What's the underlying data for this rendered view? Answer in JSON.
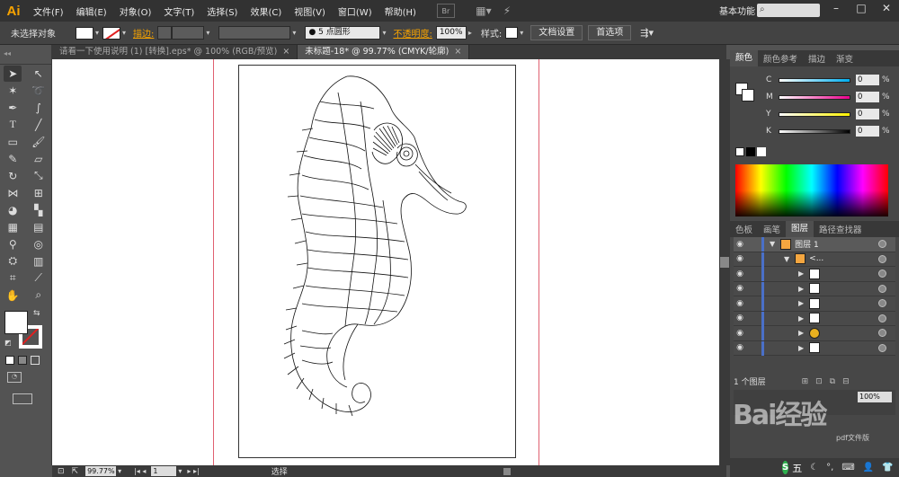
{
  "app": {
    "logo": "Ai"
  },
  "menu": [
    "文件(F)",
    "编辑(E)",
    "对象(O)",
    "文字(T)",
    "选择(S)",
    "效果(C)",
    "视图(V)",
    "窗口(W)",
    "帮助(H)"
  ],
  "menubar_icons": {
    "bridge": "Br",
    "arrange": "arrange-icon",
    "gpu": "gpu-icon"
  },
  "workspace": "基本功能",
  "control": {
    "selection": "未选择对象",
    "stroke_label": "描边:",
    "brush_value": "5 点圆形",
    "opacity_label": "不透明度:",
    "opacity_value": "100%",
    "style_label": "样式:",
    "doc_setup": "文档设置",
    "preferences": "首选项"
  },
  "tabs": [
    {
      "label": "请看一下使用说明 (1) [转换].eps* @ 100% (RGB/预览)",
      "active": false
    },
    {
      "label": "未标题-18* @ 99.77% (CMYK/轮廓)",
      "active": true
    }
  ],
  "tab_close": "×",
  "status": {
    "zoom": "99.77%",
    "page": "1",
    "tool": "选择"
  },
  "color_panel": {
    "tabs": [
      "颜色",
      "颜色参考",
      "描边",
      "渐变"
    ],
    "channels": [
      {
        "label": "C",
        "value": "0",
        "gradient": "#00aeef"
      },
      {
        "label": "M",
        "value": "0",
        "gradient": "#ec008c"
      },
      {
        "label": "Y",
        "value": "0",
        "gradient": "#fff200"
      },
      {
        "label": "K",
        "value": "0",
        "gradient": "#000000"
      }
    ],
    "unit": "%"
  },
  "layers_panel": {
    "tabs": [
      "色板",
      "画笔",
      "图层",
      "路径查找器"
    ],
    "top_layer": "图层 1",
    "group": "<...",
    "count": "1 个图层"
  },
  "panel2": {
    "value": "100%",
    "button": "pdf文件版"
  },
  "watermark": "Bai经验",
  "ime": {
    "badge": "S",
    "text": "五"
  }
}
